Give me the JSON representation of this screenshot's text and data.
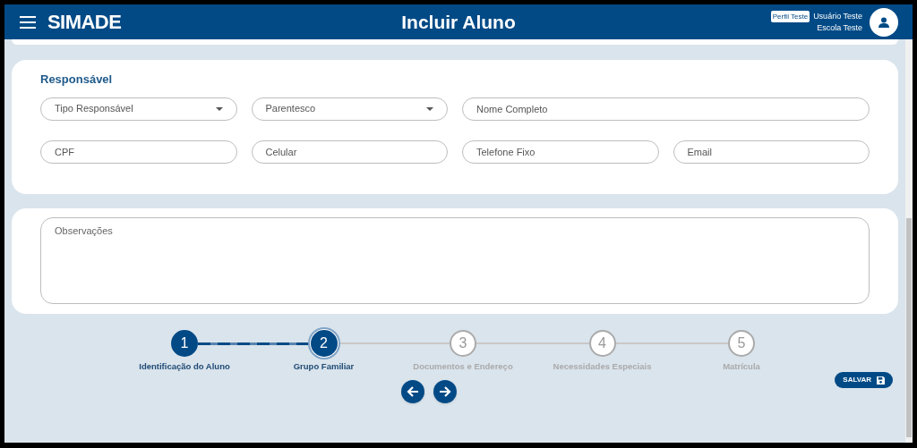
{
  "header": {
    "logo": "SIMADE",
    "title": "Incluir Aluno",
    "profile_badge": "Perfil Teste",
    "user": "Usuário Teste",
    "school": "Escola Teste"
  },
  "responsavel": {
    "title": "Responsável",
    "rows": [
      [
        {
          "kind": "select",
          "placeholder": "Tipo Responsável"
        },
        {
          "kind": "select",
          "placeholder": "Parentesco"
        },
        {
          "kind": "text",
          "placeholder": "Nome Completo"
        }
      ],
      [
        {
          "kind": "text",
          "placeholder": "CPF"
        },
        {
          "kind": "text",
          "placeholder": "Celular"
        },
        {
          "kind": "text",
          "placeholder": "Telefone Fixo"
        },
        {
          "kind": "text",
          "placeholder": "Email"
        }
      ]
    ]
  },
  "observacoes": {
    "placeholder": "Observações"
  },
  "steps": [
    {
      "number": "1",
      "label": "Identificação do Aluno",
      "completed": true,
      "selected": false
    },
    {
      "number": "2",
      "label": "Grupo Familiar",
      "completed": false,
      "selected": true
    },
    {
      "number": "3",
      "label": "Documentos e Endereço",
      "completed": false,
      "selected": false
    },
    {
      "number": "4",
      "label": "Necessidades Especiais",
      "completed": false,
      "selected": false
    },
    {
      "number": "5",
      "label": "Matrícula",
      "completed": false,
      "selected": false
    }
  ],
  "save_button": "SALVAR"
}
